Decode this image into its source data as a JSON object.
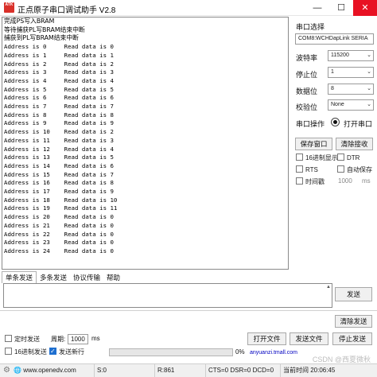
{
  "window": {
    "title": "正点原子串口调试助手 V2.8",
    "app_icon_text": "ATK",
    "min": "—",
    "max": "☐",
    "close": "✕"
  },
  "receive_lines": [
    "完成PS写入BRAM",
    "等待捕获PL写BRAM结束中断",
    "捕获到PL写BRAM结束中断",
    "Address is 0     Read data is 0",
    "Address is 1     Read data is 1",
    "Address is 2     Read data is 2",
    "Address is 3     Read data is 3",
    "Address is 4     Read data is 4",
    "Address is 5     Read data is 5",
    "Address is 6     Read data is 6",
    "Address is 7     Read data is 7",
    "Address is 8     Read data is 8",
    "Address is 9     Read data is 9",
    "Address is 10    Read data is 2",
    "Address is 11    Read data is 3",
    "Address is 12    Read data is 4",
    "Address is 13    Read data is 5",
    "Address is 14    Read data is 6",
    "Address is 15    Read data is 7",
    "Address is 16    Read data is 8",
    "Address is 17    Read data is 9",
    "Address is 18    Read data is 10",
    "Address is 19    Read data is 11",
    "Address is 20    Read data is 0",
    "Address is 21    Read data is 0",
    "Address is 22    Read data is 0",
    "Address is 23    Read data is 0",
    "Address is 24    Read data is 0"
  ],
  "settings": {
    "port_label": "串口选择",
    "port_value": "COM8:WCHDapLink SERIA",
    "baud_label": "波特率",
    "baud_value": "115200",
    "stop_label": "停止位",
    "stop_value": "1",
    "data_label": "数据位",
    "data_value": "8",
    "parity_label": "校验位",
    "parity_value": "None",
    "port_op_label": "串口操作",
    "open_port_label": "打开串口",
    "save_window_label": "保存窗口",
    "clear_receive_label": "清除接收",
    "hex_display_label": "16进制显示",
    "dtr_label": "DTR",
    "rts_label": "RTS",
    "auto_save_label": "自动保存",
    "timestamp_label": "时间戳",
    "timestamp_value": "1000",
    "timestamp_unit": "ms"
  },
  "tabs": [
    "单条发送",
    "多条发送",
    "协议传输",
    "帮助"
  ],
  "send": {
    "send_label": "发送",
    "clear_send_label": "清除发送",
    "timed_send_label": "定时发送",
    "period_label": "周期:",
    "period_value": "1000",
    "period_unit": "ms",
    "open_file_label": "打开文件",
    "send_file_label": "发送文件",
    "stop_send_label": "停止发送",
    "hex_send_label": "16进制发送",
    "send_newline_label": "发送新行",
    "progress_text": "0%",
    "progress_value": 0,
    "link_text": "anyuanzi.tmall.com"
  },
  "status": {
    "url": "www.openedv.com",
    "s": "S:0",
    "r": "R:861",
    "signals": "CTS=0 DSR=0 DCD=0",
    "time": "当前时间 20:06:45"
  },
  "watermark": "CSDN @西夏微秋",
  "colors": {
    "accent": "#1f6fd0",
    "close": "#e81123",
    "progress": "#06b025"
  }
}
